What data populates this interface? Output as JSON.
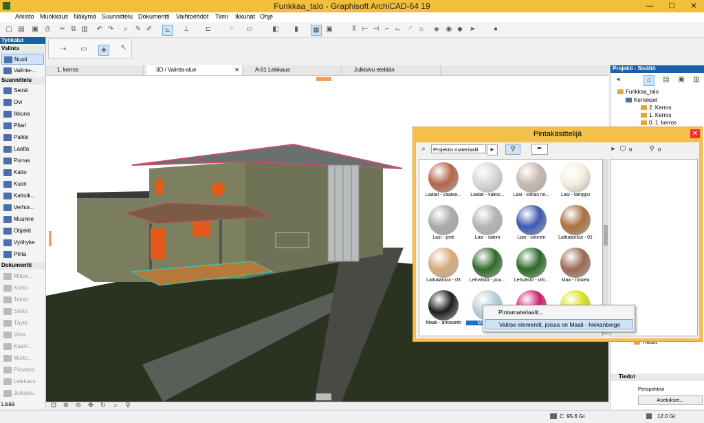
{
  "window": {
    "title": "Funkkaa_talo - Graphisoft ArchiCAD-64 19",
    "minimize": "—",
    "maximize": "☐",
    "close": "✕"
  },
  "menu": [
    "Arkisto",
    "Muokkaus",
    "Näkymä",
    "Suunnittelu",
    "Dokumentti",
    "Vaihtoehdot",
    "Tiimi",
    "Ikkunat",
    "Ohje"
  ],
  "toolbox": {
    "header": "Työkalut",
    "select_section": "Valinta",
    "select_items": [
      "Nuoli",
      "Valinta-..."
    ],
    "design_section": "Suunnittelu",
    "design_items": [
      "Seinä",
      "Ovi",
      "Ikkuna",
      "Pilari",
      "Palkki",
      "Laatta",
      "Porras",
      "Katto",
      "Kuori",
      "Kattoik...",
      "Verhor...",
      "Muunne",
      "Objekti",
      "Vyöhyke",
      "Pinta"
    ],
    "doc_section": "Dokumentti",
    "doc_items": [
      "Mittav...",
      "Korko",
      "Teksti",
      "Selite",
      "Täyte",
      "Viiva",
      "Kaari/...",
      "Murto...",
      "Piirustus",
      "Leikkaus",
      "Julkisivu"
    ],
    "more": "Lisää"
  },
  "tabs": [
    "1. kerros",
    "3D / Valinta-alue",
    "A-01 Leikkaus",
    "Julkisivu etelään"
  ],
  "navigator": {
    "header": "Projekti - Sisältö",
    "tree": [
      "Funkkaa_talo",
      "Kerrokset",
      "2. Kerros",
      "1. Kerros",
      "0. 1. kerros"
    ],
    "tiedot_item": "Tiedot",
    "info_section": "Tiedot",
    "perspective": "Perspektiivi",
    "settings_button": "Asetukset..."
  },
  "painter": {
    "title": "Pintakäsittelijä",
    "search_placeholder": "Projektin materiaalit",
    "right_count_a": "0",
    "right_count_b": "0",
    "materials": [
      {
        "label": "Laatat - vaalea...",
        "color": "#b5654a"
      },
      {
        "label": "Laatat - valkoi...",
        "color": "#d8d8d8"
      },
      {
        "label": "Lasi - kirkas no...",
        "color": "#c9b8b0"
      },
      {
        "label": "Lasi - lamppu",
        "color": "#f4f0e0"
      },
      {
        "label": "Lasi - peili",
        "color": "#a9a9a9"
      },
      {
        "label": "Lasi - satiini",
        "color": "#b4b4b4"
      },
      {
        "label": "Lasi - sininen",
        "color": "#3d5ab0"
      },
      {
        "label": "Lattialankut - 01",
        "color": "#a9703e"
      },
      {
        "label": "Lattialankut - 03",
        "color": "#d8aa7e"
      },
      {
        "label": "Lehvästö - puu...",
        "color": "#2f6b2a"
      },
      {
        "label": "Lehvästö - villi...",
        "color": "#2b6a28"
      },
      {
        "label": "Maa - ruskea",
        "color": "#9a6a55"
      },
      {
        "label": "Maali - antrasiitti",
        "color": "#1e1e1e"
      },
      {
        "label": "Maali - ...",
        "color": "#b5cfd8"
      },
      {
        "label": "",
        "color": "#cc1f6f"
      },
      {
        "label": "",
        "color": "#d9e21a"
      }
    ]
  },
  "context_menu": {
    "item1": "Pintamateriaalit...",
    "item2": "Valitse elementit, joissa on Maali - hiekanbeige"
  },
  "status": {
    "disk": "C: 95.6 Gt",
    "ram": "12.0 Gt"
  }
}
